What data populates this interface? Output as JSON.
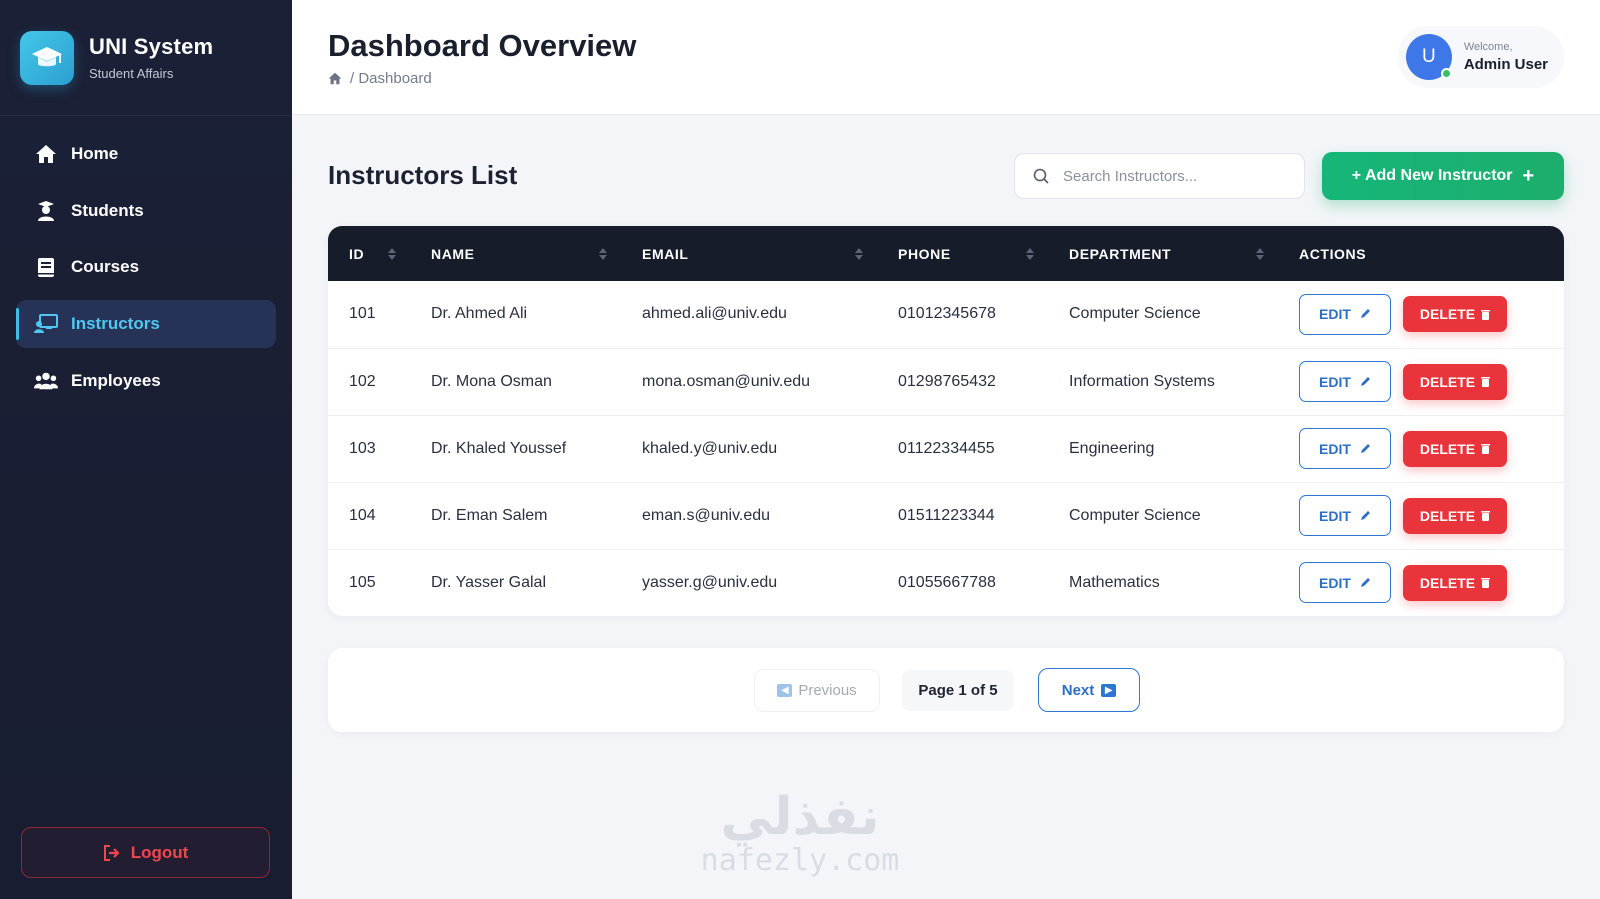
{
  "brand": {
    "title": "UNI System",
    "subtitle": "Student Affairs",
    "icon": "graduation-cap-icon"
  },
  "sidebar": {
    "items": [
      {
        "label": "Home",
        "icon": "home-icon",
        "active": false
      },
      {
        "label": "Students",
        "icon": "student-icon",
        "active": false
      },
      {
        "label": "Courses",
        "icon": "book-icon",
        "active": false
      },
      {
        "label": "Instructors",
        "icon": "chalkboard-teacher-icon",
        "active": true
      },
      {
        "label": "Employees",
        "icon": "users-icon",
        "active": false
      }
    ],
    "logout_label": "Logout"
  },
  "header": {
    "title": "Dashboard Overview",
    "breadcrumb": "/ Dashboard",
    "user": {
      "welcome": "Welcome,",
      "name": "Admin User",
      "initial": "U"
    }
  },
  "main": {
    "section_title": "Instructors List",
    "search_placeholder": "Search Instructors...",
    "add_button": "+ Add New Instructor",
    "table": {
      "columns": [
        "ID",
        "NAME",
        "EMAIL",
        "PHONE",
        "DEPARTMENT",
        "ACTIONS"
      ],
      "rows": [
        {
          "id": "101",
          "name": "Dr. Ahmed Ali",
          "email": "ahmed.ali@univ.edu",
          "phone": "01012345678",
          "department": "Computer Science"
        },
        {
          "id": "102",
          "name": "Dr. Mona Osman",
          "email": "mona.osman@univ.edu",
          "phone": "01298765432",
          "department": "Information Systems"
        },
        {
          "id": "103",
          "name": "Dr. Khaled Youssef",
          "email": "khaled.y@univ.edu",
          "phone": "01122334455",
          "department": "Engineering"
        },
        {
          "id": "104",
          "name": "Dr. Eman Salem",
          "email": "eman.s@univ.edu",
          "phone": "01511223344",
          "department": "Computer Science"
        },
        {
          "id": "105",
          "name": "Dr. Yasser Galal",
          "email": "yasser.g@univ.edu",
          "phone": "01055667788",
          "department": "Mathematics"
        }
      ],
      "edit_label": "EDIT",
      "delete_label": "DELETE"
    },
    "pagination": {
      "previous": "Previous",
      "page_info": "Page 1 of 5",
      "next": "Next"
    }
  },
  "watermark": {
    "arabic": "نفذلي",
    "latin": "nafezly.com"
  },
  "colors": {
    "sidebar_bg": "#1b2036",
    "accent_blue": "#2d77d2",
    "add_green": "#1cae6c",
    "delete_red": "#e8343a",
    "logout_red": "#f0474f",
    "active_cyan": "#4fc7f2"
  }
}
